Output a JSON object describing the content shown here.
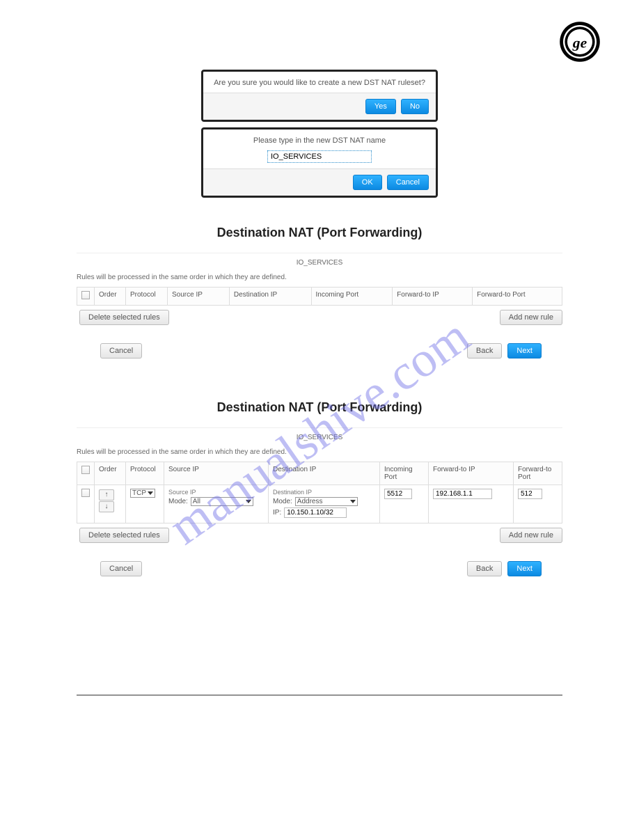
{
  "watermark": "manualshive.com",
  "dialogs": {
    "confirm": {
      "msg": "Are you sure you would like to create a new DST NAT ruleset?",
      "yes": "Yes",
      "no": "No"
    },
    "name": {
      "prompt": "Please type in the new DST NAT name",
      "value": "IO_SERVICES",
      "ok": "OK",
      "cancel": "Cancel"
    }
  },
  "section1": {
    "title": "Destination NAT (Port Forwarding)",
    "ruleset": "IO_SERVICES",
    "note": "Rules will be processed in the same order in which they are defined.",
    "cols": {
      "order": "Order",
      "protocol": "Protocol",
      "sourceip": "Source IP",
      "destip": "Destination IP",
      "inport": "Incoming Port",
      "fwdip": "Forward-to IP",
      "fwdport": "Forward-to Port"
    },
    "del_btn": "Delete selected rules",
    "add_btn": "Add new rule",
    "cancel": "Cancel",
    "back": "Back",
    "next": "Next"
  },
  "section2": {
    "title": "Destination NAT (Port Forwarding)",
    "ruleset": "IO_SERVICES",
    "note": "Rules will be processed in the same order in which they are defined.",
    "cols": {
      "order": "Order",
      "protocol": "Protocol",
      "sourceip": "Source IP",
      "destip": "Destination IP",
      "inport": "Incoming Port",
      "fwdip": "Forward-to IP",
      "fwdport": "Forward-to Port"
    },
    "row": {
      "protocol": "TCP",
      "src": {
        "legend": "Source IP",
        "mode_lbl": "Mode:",
        "mode": "All"
      },
      "dst": {
        "legend": "Destination IP",
        "mode_lbl": "Mode:",
        "mode": "Address",
        "ip_lbl": "IP:",
        "ip": "10.150.1.10/32"
      },
      "inport": "5512",
      "fwdip": "192.168.1.1",
      "fwdport": "512"
    },
    "del_btn": "Delete selected rules",
    "add_btn": "Add new rule",
    "cancel": "Cancel",
    "back": "Back",
    "next": "Next"
  }
}
